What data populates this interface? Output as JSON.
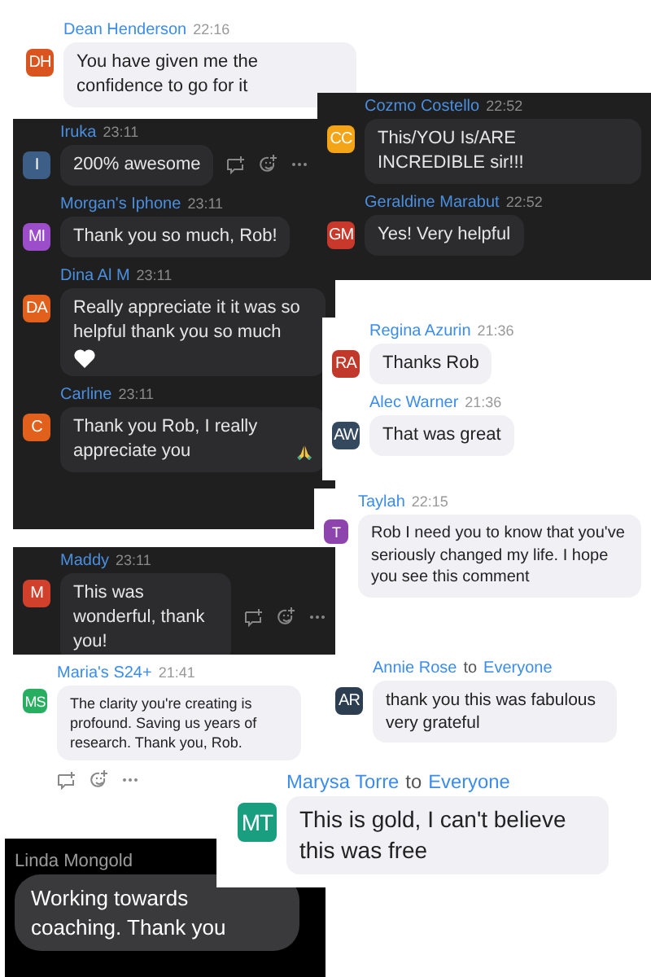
{
  "panels": [
    {
      "kind": "light",
      "messages": [
        {
          "kind": "plain",
          "sender": "Dean Henderson",
          "time": "22:16",
          "initials": "DH",
          "color": "#d9541e",
          "text": "You have given me the confidence to go for it"
        }
      ]
    },
    {
      "kind": "dark",
      "messages": [
        {
          "kind": "actions",
          "sender": "Iruka",
          "time": "23:11",
          "initials": "I",
          "color": "#3d5f87",
          "text": "200% awesome"
        },
        {
          "kind": "plain",
          "sender": "Morgan's Iphone",
          "time": "23:11",
          "initials": "MI",
          "color": "#9b4dca",
          "text": "Thank you so much, Rob!"
        },
        {
          "kind": "heart",
          "sender": "Dina Al M",
          "time": "23:11",
          "initials": "DA",
          "color": "#e0601c",
          "text": "Really appreciate it it was so helpful thank you so much"
        },
        {
          "kind": "pray",
          "sender": "Carline",
          "time": "23:11",
          "initials": "C",
          "color": "#e0601c",
          "text": "Thank you Rob, I really appreciate you"
        }
      ]
    },
    {
      "kind": "dark",
      "messages": [
        {
          "kind": "plain",
          "sender": "Cozmo Costello",
          "time": "22:52",
          "initials": "CC",
          "color": "#f3a417",
          "text": "This/YOU Is/ARE INCREDIBLE sir!!!"
        },
        {
          "kind": "plain",
          "sender": "Geraldine Marabut",
          "time": "22:52",
          "initials": "GM",
          "color": "#c8392b",
          "text": "Yes! Very helpful"
        }
      ]
    },
    {
      "kind": "light",
      "messages": [
        {
          "kind": "plain",
          "sender": "Regina Azurin",
          "time": "21:36",
          "initials": "RA",
          "color": "#c0392b",
          "text": "Thanks Rob"
        },
        {
          "kind": "plain",
          "sender": "Alec Warner",
          "time": "21:36",
          "initials": "AW",
          "color": "#34495e",
          "text": "That was great"
        }
      ]
    },
    {
      "kind": "light",
      "messages": [
        {
          "kind": "plain",
          "sender": "Taylah",
          "time": "22:15",
          "initials": "T",
          "color": "#8e44ad",
          "text": "Rob I need you to know that you've seriously changed my life. I hope you see this comment"
        }
      ]
    },
    {
      "kind": "dark",
      "messages": [
        {
          "kind": "actions",
          "sender": "Maddy",
          "time": "23:11",
          "initials": "M",
          "color": "#d0402b",
          "text": "This was wonderful, thank you!"
        }
      ]
    },
    {
      "kind": "light",
      "messages": [
        {
          "kind": "actions_below",
          "sender": "Maria's S24+",
          "time": "21:41",
          "initials": "MS",
          "color": "#27ae60",
          "text": "The clarity you're creating is profound.  Saving us years of research. Thank you, Rob."
        }
      ]
    },
    {
      "kind": "light",
      "messages": [
        {
          "kind": "plain",
          "sender": "Annie Rose",
          "to": "to",
          "recipient": "Everyone",
          "initials": "AR",
          "color": "#2c3e50",
          "text": "thank you this was fabulous very grateful"
        }
      ]
    },
    {
      "kind": "light",
      "messages": [
        {
          "kind": "plain",
          "sender": "Marysa Torre",
          "to": "to",
          "recipient": "Everyone",
          "initials": "MT",
          "color": "#1a9e80",
          "text": "This is gold, I can't believe this was free"
        }
      ]
    },
    {
      "kind": "black",
      "messages": [
        {
          "kind": "plain",
          "sender": "Linda Mongold",
          "text": "Working towards coaching. Thank you"
        }
      ]
    }
  ]
}
